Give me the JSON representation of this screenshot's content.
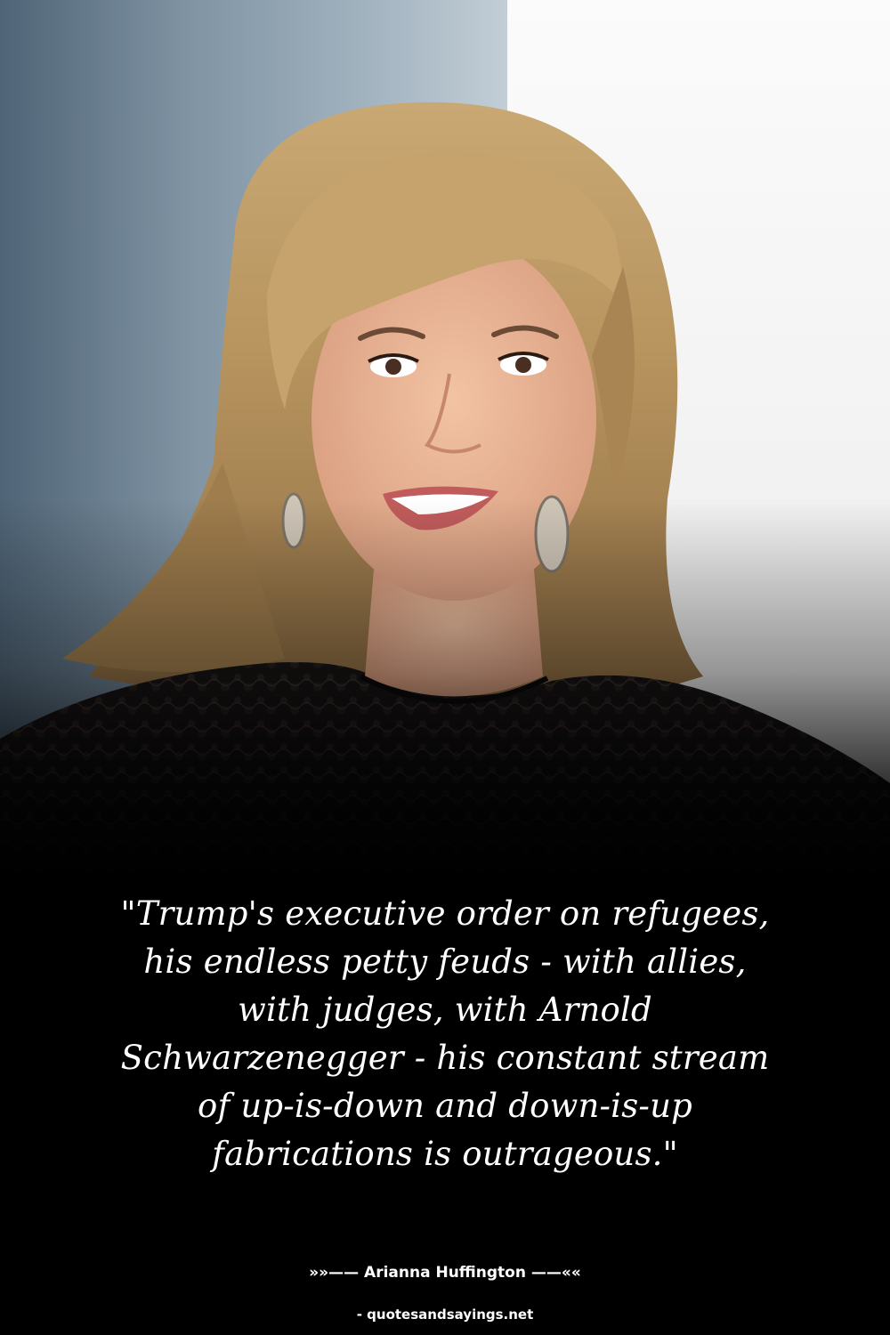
{
  "quote": {
    "lines": [
      "\"Trump's executive order on refugees,",
      "his endless petty feuds - with allies,",
      "with judges, with Arnold",
      "Schwarzenegger - his constant stream",
      "of up-is-down and down-is-up",
      "fabrications is outrageous.\""
    ]
  },
  "attribution": {
    "prefix": "»»—— ",
    "author": "Arianna Huffington",
    "suffix": " ——««"
  },
  "source": {
    "label": "- quotesandsayings.net"
  },
  "colors": {
    "background": "#000000",
    "text": "#ffffff",
    "hair": "#b8955f",
    "dress": "#141111"
  }
}
